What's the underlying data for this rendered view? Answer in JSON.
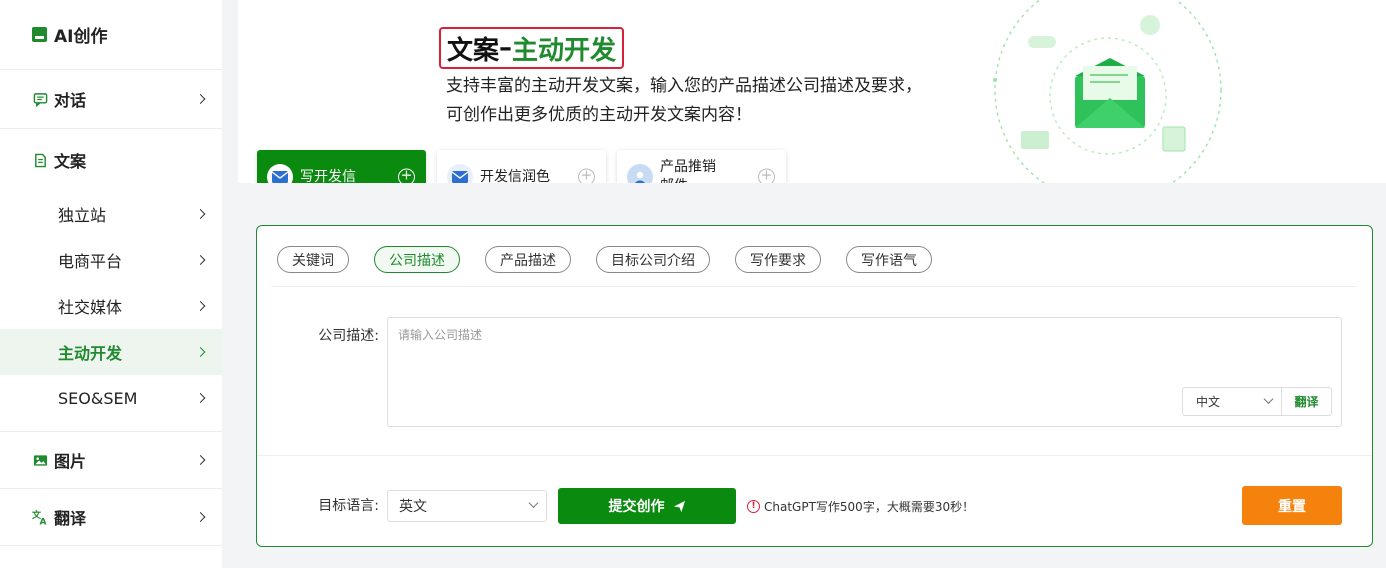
{
  "sidebar": {
    "logo": "AI创作",
    "groups": [
      {
        "label": "对话",
        "icon": "chat-icon"
      },
      {
        "label": "文案",
        "icon": "document-icon",
        "items": [
          {
            "label": "独立站"
          },
          {
            "label": "电商平台"
          },
          {
            "label": "社交媒体"
          },
          {
            "label": "主动开发",
            "active": true
          },
          {
            "label": "SEO&SEM"
          }
        ]
      },
      {
        "label": "图片",
        "icon": "image-icon"
      },
      {
        "label": "翻译",
        "icon": "translate-icon"
      }
    ]
  },
  "banner": {
    "title_prefix": "文案",
    "title_dash": "–",
    "title_highlight": "主动开发",
    "description_line1": "支持丰富的主动开发文案，输入您的产品描述公司描述及要求，",
    "description_line2": "可创作出更多优质的主动开发文案内容！"
  },
  "tabs": [
    {
      "label": "写开发信",
      "active": true,
      "icon": "envelope-icon"
    },
    {
      "label": "开发信润色",
      "icon": "envelope-icon"
    },
    {
      "label_line1": "产品推销",
      "label_line2": "邮件",
      "icon": "person-icon"
    }
  ],
  "form": {
    "chips": [
      "关键词",
      "公司描述",
      "产品描述",
      "目标公司介绍",
      "写作要求",
      "写作语气"
    ],
    "active_chip": "公司描述",
    "field_label": "公司描述:",
    "field_placeholder": "请输入公司描述",
    "source_language": "中文",
    "translate_label": "翻译",
    "target_language_label": "目标语言:",
    "target_language": "英文",
    "submit_label": "提交创作",
    "notice": "ChatGPT写作500字，大概需要30秒！",
    "reset_label": "重置"
  },
  "colors": {
    "brand_green": "#0b8a10",
    "title_border": "#d8203a",
    "reset_orange": "#f5820d"
  }
}
